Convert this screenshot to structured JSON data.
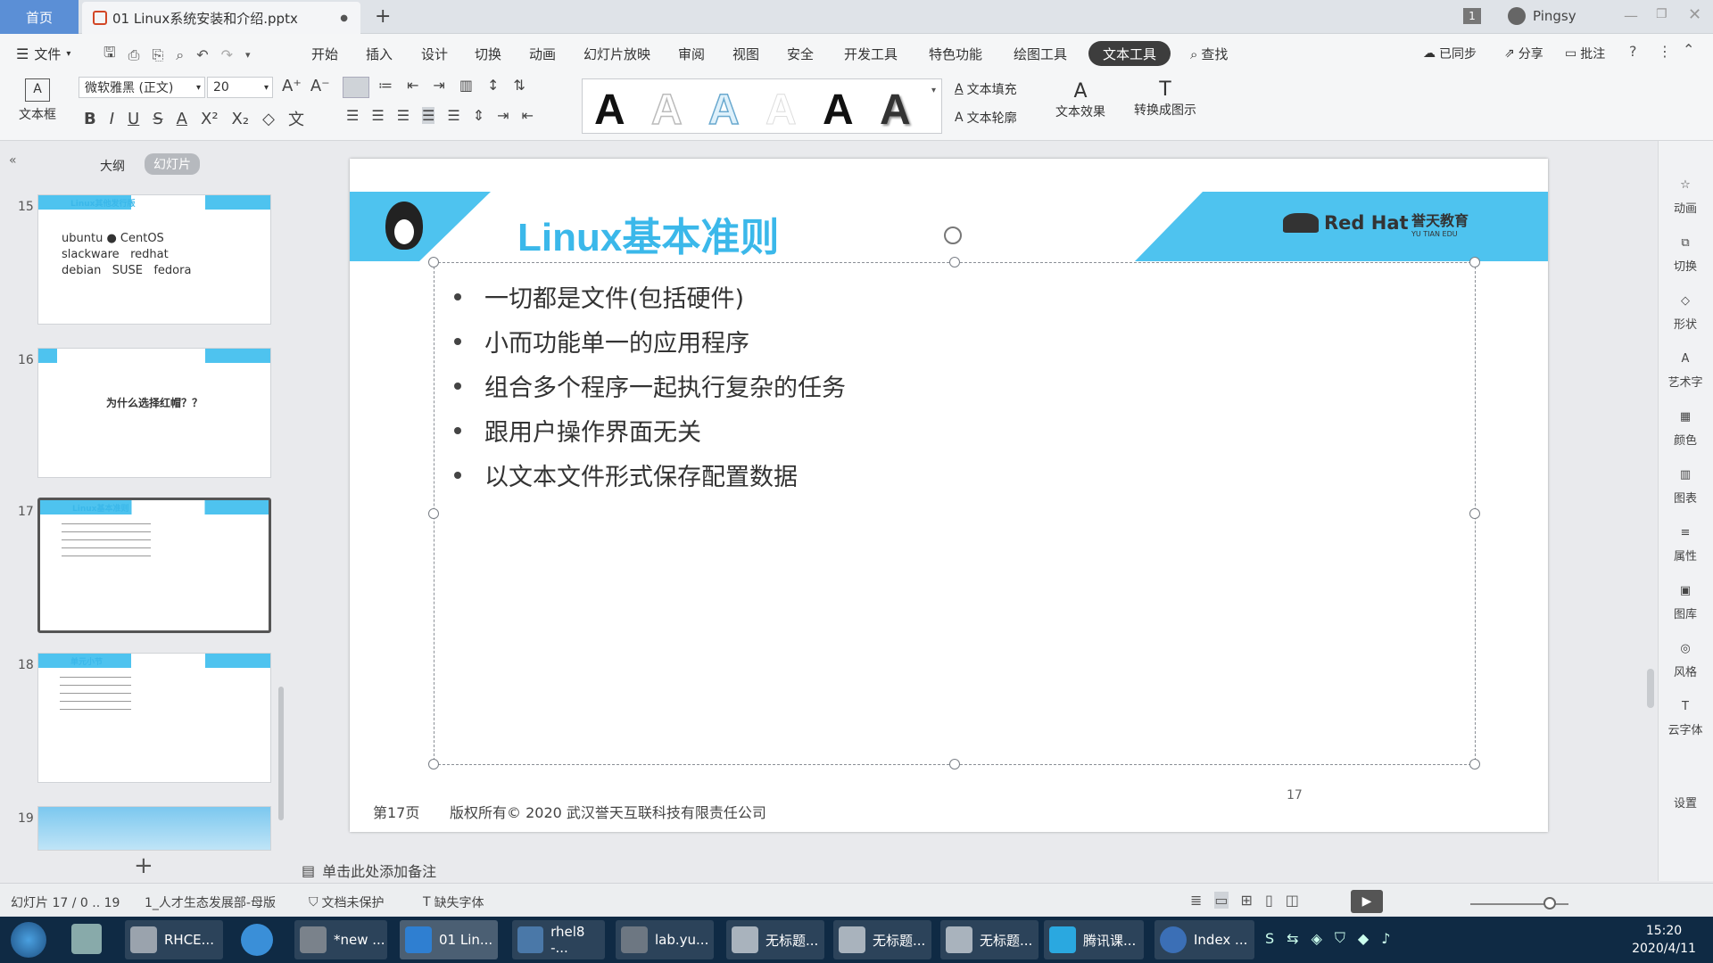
{
  "titlebar": {
    "home_tab": "首页",
    "doc_tab": "01 Linux系统安装和介绍.pptx",
    "new_tab": "+",
    "badge": "1",
    "user": "Pingsy"
  },
  "menubar": {
    "file": "文件",
    "items": [
      "开始",
      "插入",
      "设计",
      "切换",
      "动画",
      "幻灯片放映",
      "审阅",
      "视图",
      "安全",
      "开发工具",
      "特色功能",
      "绘图工具",
      "文本工具"
    ],
    "search": "查找",
    "sync": "已同步",
    "share": "分享",
    "comment": "批注"
  },
  "ribbon": {
    "textbox_label": "文本框",
    "font_name": "微软雅黑 (正文)",
    "font_size": "20",
    "text_fill": "文本填充",
    "text_outline": "文本轮廓",
    "text_effect": "文本效果",
    "convert_smartart": "转换成图示"
  },
  "leftpane": {
    "tab_outline": "大纲",
    "tab_slides": "幻灯片",
    "thumbs": [
      {
        "num": "15",
        "title": "Linux其他发行版"
      },
      {
        "num": "16",
        "title": "为什么选择红帽？？"
      },
      {
        "num": "17",
        "title": "Linux基本准则"
      },
      {
        "num": "18",
        "title": "单元小节"
      },
      {
        "num": "19",
        "title": ""
      }
    ],
    "add": "+"
  },
  "slide": {
    "title": "Linux基本准则",
    "logo_redhat": "Red Hat",
    "logo_edu": "誉天教育",
    "logo_edu_en": "YU TIAN EDU",
    "bullets": [
      "一切都是文件(包括硬件)",
      "小而功能单一的应用程序",
      "组合多个程序一起执行复杂的任务",
      "跟用户操作界面无关",
      "以文本文件形式保存配置数据"
    ],
    "footer_page": "第17页",
    "footer_copyright": "版权所有© 2020 武汉誉天互联科技有限责任公司",
    "page_number": "17"
  },
  "notes": "单击此处添加备注",
  "rightpane": [
    "动画",
    "切换",
    "形状",
    "艺术字",
    "颜色",
    "图表",
    "属性",
    "图库",
    "风格",
    "云字体",
    "设置"
  ],
  "statusbar": {
    "slide_info": "幻灯片 17 / 0 .. 19",
    "master": "1_人才生态发展部-母版",
    "protect": "文档未保护",
    "missing_font": "缺失字体"
  },
  "taskbar": {
    "tasks": [
      "RHCE...",
      "*new ...",
      "01 Lin...",
      "rhel8 -...",
      "lab.yu...",
      "无标题...",
      "无标题...",
      "无标题...",
      "腾讯课...",
      "Index ..."
    ],
    "time": "15:20",
    "date": "2020/4/11"
  },
  "colors": {
    "accent": "#4ec3ef",
    "title": "#3bb8ea",
    "taskbar": "#0f2a44"
  }
}
